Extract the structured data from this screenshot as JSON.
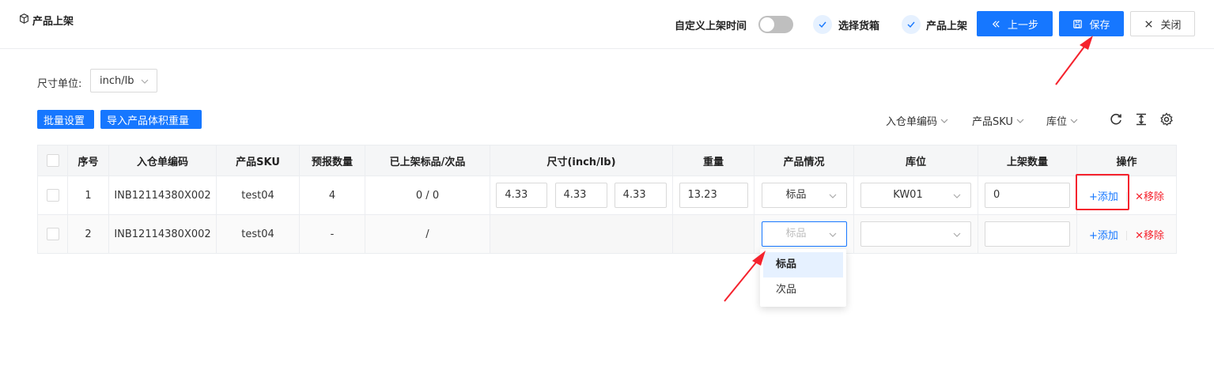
{
  "header": {
    "title": "产品上架",
    "custom_time_label": "自定义上架时间",
    "step1": "选择货箱",
    "step2": "产品上架",
    "prev_label": "上一步",
    "save_label": "保存",
    "close_label": "关闭"
  },
  "unit": {
    "label": "尺寸单位:",
    "value": "inch/lb"
  },
  "toolbar": {
    "batch_label": "批量设置",
    "import_label": "导入产品体积重量",
    "filters": [
      "入仓单编码",
      "产品SKU",
      "库位"
    ]
  },
  "table": {
    "headers": [
      "序号",
      "入仓单编码",
      "产品SKU",
      "预报数量",
      "已上架标品/次品",
      "尺寸(inch/lb)",
      "重量",
      "产品情况",
      "库位",
      "上架数量",
      "操作"
    ],
    "rows": [
      {
        "index": "1",
        "order_code": "INB12114380X002",
        "sku": "test04",
        "forecast": "4",
        "shelved": "0 / 0",
        "dim_l": "4.33",
        "dim_w": "4.33",
        "dim_h": "4.33",
        "weight": "13.23",
        "condition": "标品",
        "location": "KW01",
        "qty": "0",
        "add": "+添加",
        "remove": "✕移除"
      },
      {
        "index": "2",
        "order_code": "INB12114380X002",
        "sku": "test04",
        "forecast": "-",
        "shelved": "/",
        "condition_placeholder": "标品",
        "add": "+添加",
        "remove": "✕移除"
      }
    ]
  },
  "dropdown": {
    "options": [
      "标品",
      "次品"
    ],
    "selected": "标品"
  },
  "colors": {
    "primary": "#1677ff",
    "danger": "#f5222d",
    "header_bg": "#f5f6f7"
  }
}
